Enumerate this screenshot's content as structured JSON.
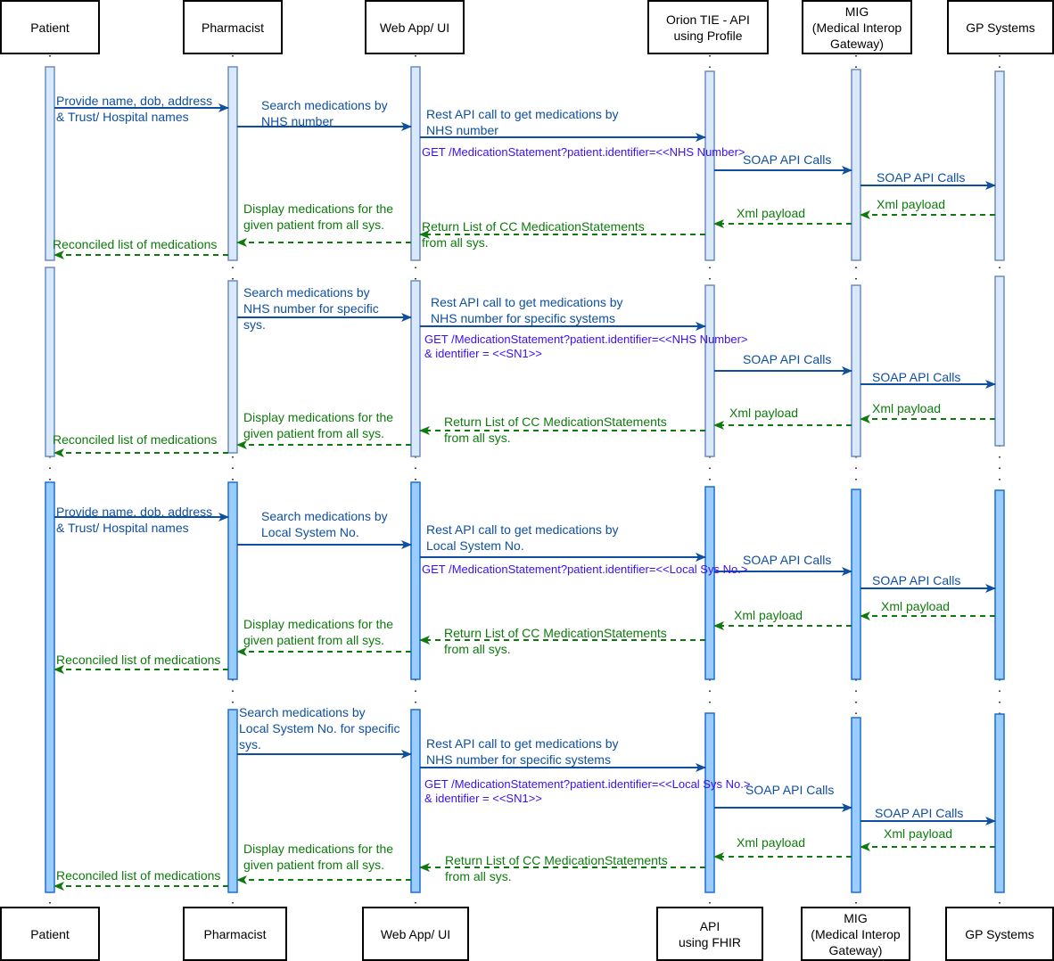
{
  "colors": {
    "call_arrow": "#0f4fa0",
    "return_arrow": "#0e7a0d",
    "request_text": "#3b0ff0",
    "activation_light_fill": "#dae8fc",
    "activation_light_stroke": "#6c8ebf",
    "activation_dark_fill": "#99ccff",
    "activation_dark_stroke": "#1f6fd0"
  },
  "actors_top": [
    {
      "id": "patient",
      "label": "Patient"
    },
    {
      "id": "pharmacist",
      "label": "Pharmacist"
    },
    {
      "id": "webapp",
      "label": "Web App/ UI"
    },
    {
      "id": "api",
      "label": "Orion TIE - API\nusing Profile"
    },
    {
      "id": "mig",
      "label": "MIG\n(Medical Interop\nGateway)"
    },
    {
      "id": "gp",
      "label": "GP Systems"
    }
  ],
  "actors_bottom": [
    {
      "id": "patient",
      "label": "Patient"
    },
    {
      "id": "pharmacist",
      "label": "Pharmacist"
    },
    {
      "id": "webapp",
      "label": "Web App/ UI"
    },
    {
      "id": "api",
      "label": "API\nusing FHIR"
    },
    {
      "id": "mig",
      "label": "MIG\n(Medical Interop\nGateway)"
    },
    {
      "id": "gp",
      "label": "GP Systems"
    }
  ],
  "scenarios": [
    {
      "name": "nhs-number-all-systems",
      "style": "light",
      "messages": [
        {
          "from": "patient",
          "to": "pharmacist",
          "kind": "call",
          "label": "Provide name, dob, address\n& Trust/ Hospital names"
        },
        {
          "from": "pharmacist",
          "to": "webapp",
          "kind": "call",
          "label": "Search medications by\n NHS number"
        },
        {
          "from": "webapp",
          "to": "api",
          "kind": "call",
          "label": "Rest API call to get medications by\nNHS number",
          "request": "GET /MedicationStatement?patient.identifier=<<NHS Number>"
        },
        {
          "from": "api",
          "to": "mig",
          "kind": "call",
          "label": "SOAP API Calls"
        },
        {
          "from": "mig",
          "to": "gp",
          "kind": "call",
          "label": "SOAP API Calls"
        },
        {
          "from": "gp",
          "to": "mig",
          "kind": "return",
          "label": "Xml payload"
        },
        {
          "from": "mig",
          "to": "api",
          "kind": "return",
          "label": "Xml payload"
        },
        {
          "from": "api",
          "to": "webapp",
          "kind": "return",
          "label": "Return List of CC MedicationStatements\nfrom all sys."
        },
        {
          "from": "webapp",
          "to": "pharmacist",
          "kind": "return",
          "label": "Display medications for the\n given patient from all sys."
        },
        {
          "from": "pharmacist",
          "to": "patient",
          "kind": "return",
          "label": "Reconciled list of medications"
        }
      ]
    },
    {
      "name": "nhs-number-specific-systems",
      "style": "light",
      "messages": [
        {
          "from": "pharmacist",
          "to": "webapp",
          "kind": "call",
          "label": "Search medications by\nNHS number for specific\nsys."
        },
        {
          "from": "webapp",
          "to": "api",
          "kind": "call",
          "label": "Rest API call to get medications by\nNHS number for specific systems",
          "request": "GET /MedicationStatement?patient.identifier=<<NHS Number>\n& identifier = <<SN1>>"
        },
        {
          "from": "api",
          "to": "mig",
          "kind": "call",
          "label": "SOAP API Calls"
        },
        {
          "from": "mig",
          "to": "gp",
          "kind": "call",
          "label": "SOAP API Calls"
        },
        {
          "from": "gp",
          "to": "mig",
          "kind": "return",
          "label": "Xml payload"
        },
        {
          "from": "mig",
          "to": "api",
          "kind": "return",
          "label": "Xml payload"
        },
        {
          "from": "api",
          "to": "webapp",
          "kind": "return",
          "label": "Return List of CC MedicationStatements\nfrom all sys."
        },
        {
          "from": "webapp",
          "to": "pharmacist",
          "kind": "return",
          "label": "Display medications for the\n given patient from all sys."
        },
        {
          "from": "pharmacist",
          "to": "patient",
          "kind": "return",
          "label": "Reconciled list of medications"
        }
      ]
    },
    {
      "name": "local-system-all-systems",
      "style": "dark",
      "messages": [
        {
          "from": "patient",
          "to": "pharmacist",
          "kind": "call",
          "label": "Provide name, dob, address\n& Trust/ Hospital names"
        },
        {
          "from": "pharmacist",
          "to": "webapp",
          "kind": "call",
          "label": "Search medications by\n Local System No."
        },
        {
          "from": "webapp",
          "to": "api",
          "kind": "call",
          "label": "Rest API call to get medications by\nLocal System No.",
          "request": "GET /MedicationStatement?patient.identifier=<<Local Sys No.>"
        },
        {
          "from": "api",
          "to": "mig",
          "kind": "call",
          "label": "SOAP API Calls"
        },
        {
          "from": "mig",
          "to": "gp",
          "kind": "call",
          "label": "SOAP API Calls"
        },
        {
          "from": "gp",
          "to": "mig",
          "kind": "return",
          "label": "Xml payload"
        },
        {
          "from": "mig",
          "to": "api",
          "kind": "return",
          "label": "Xml payload"
        },
        {
          "from": "api",
          "to": "webapp",
          "kind": "return",
          "label": "Return List of CC MedicationStatements\nfrom all sys."
        },
        {
          "from": "webapp",
          "to": "pharmacist",
          "kind": "return",
          "label": "Display medications for the\ngiven patient from all sys."
        },
        {
          "from": "pharmacist",
          "to": "patient",
          "kind": "return",
          "label": "Reconciled list of medications"
        }
      ]
    },
    {
      "name": "local-system-specific-systems",
      "style": "dark",
      "messages": [
        {
          "from": "pharmacist",
          "to": "webapp",
          "kind": "call",
          "label": "Search medications by\nLocal System No. for specific\nsys."
        },
        {
          "from": "webapp",
          "to": "api",
          "kind": "call",
          "label": "Rest API call to get medications by\nNHS number for specific systems",
          "request": "GET /MedicationStatement?patient.identifier=<<Local Sys No.>\n& identifier = <<SN1>>"
        },
        {
          "from": "api",
          "to": "mig",
          "kind": "call",
          "label": "SOAP API Calls"
        },
        {
          "from": "mig",
          "to": "gp",
          "kind": "call",
          "label": "SOAP API Calls"
        },
        {
          "from": "gp",
          "to": "mig",
          "kind": "return",
          "label": "Xml payload"
        },
        {
          "from": "mig",
          "to": "api",
          "kind": "return",
          "label": "Xml payload"
        },
        {
          "from": "api",
          "to": "webapp",
          "kind": "return",
          "label": "Return List of CC MedicationStatements\nfrom all sys."
        },
        {
          "from": "webapp",
          "to": "pharmacist",
          "kind": "return",
          "label": "Display medications for the\ngiven patient from all sys."
        },
        {
          "from": "pharmacist",
          "to": "patient",
          "kind": "return",
          "label": "Reconciled list of medications"
        }
      ]
    }
  ]
}
